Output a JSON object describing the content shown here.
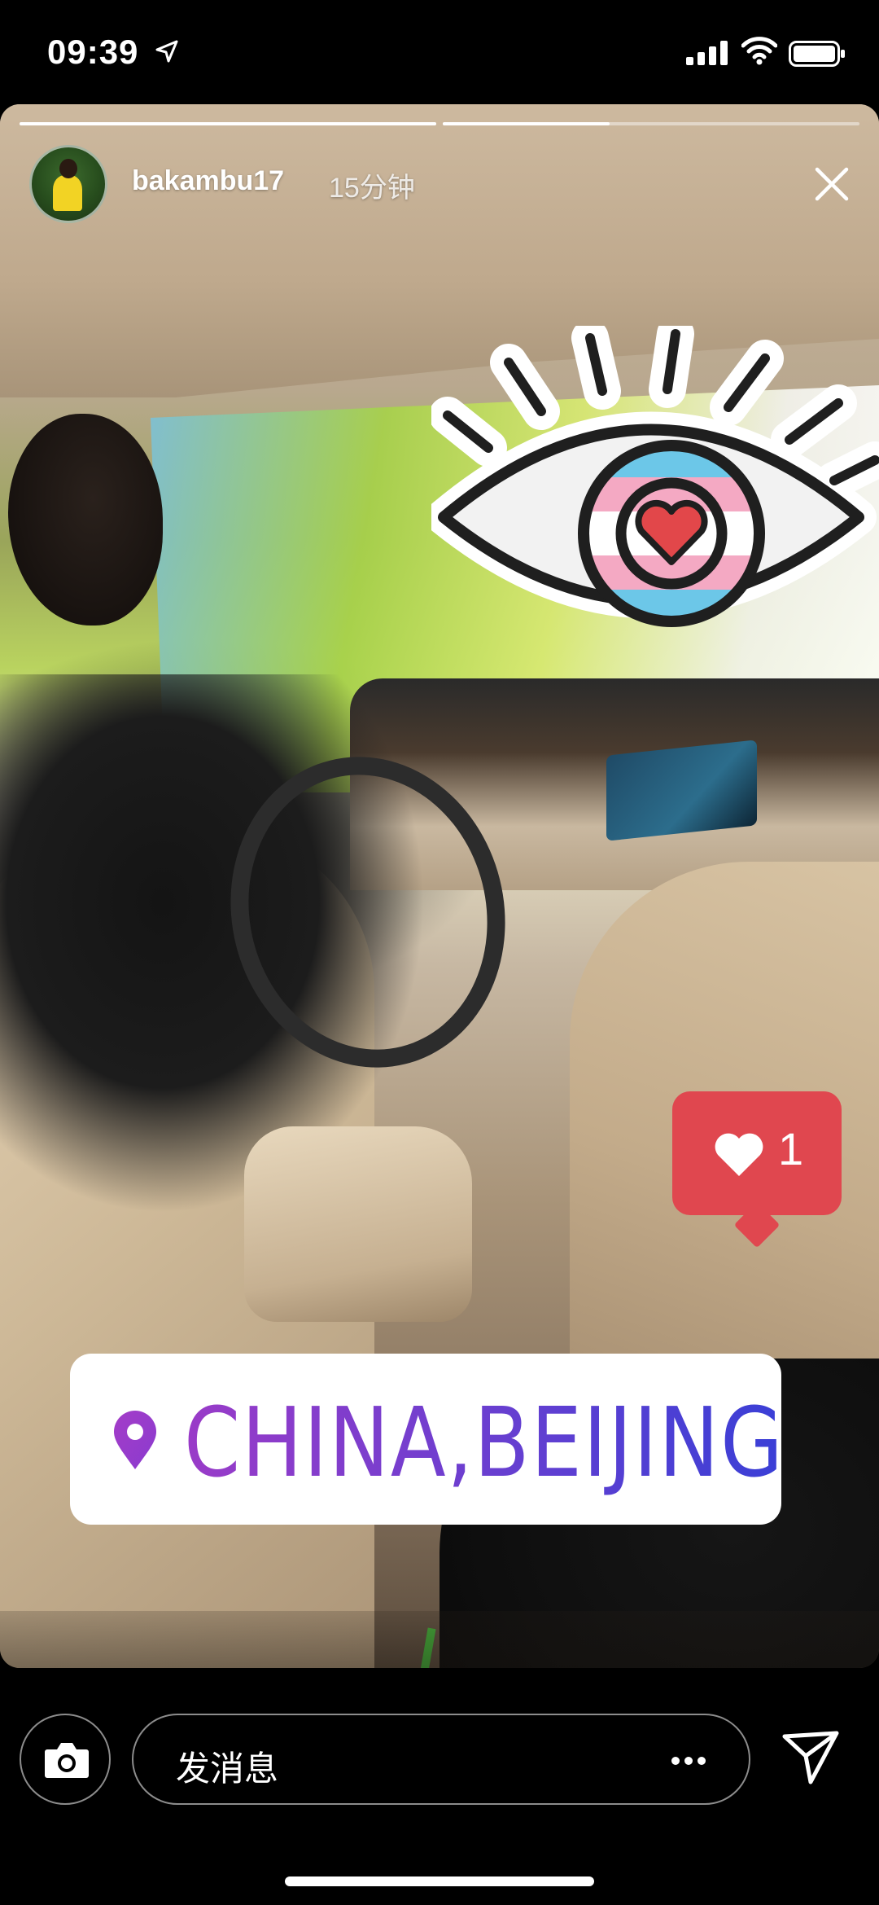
{
  "status_bar": {
    "time": "09:39",
    "icons": [
      "location-arrow-icon",
      "cellular-signal-icon",
      "wifi-icon",
      "battery-icon"
    ]
  },
  "story": {
    "progress": [
      {
        "segment": 1,
        "fill": 1.0
      },
      {
        "segment": 2,
        "fill": 0.4
      }
    ],
    "username": "bakambu17",
    "timestamp": "15分钟",
    "close_icon": "close-icon"
  },
  "stickers": {
    "eye": {
      "icon": "eye-heart-icon",
      "colors": {
        "pink": "#f4a9c3",
        "blue": "#6cc7e8",
        "heart": "#e2474a"
      }
    },
    "like": {
      "icon": "heart-icon",
      "count": "1",
      "color": "#e0474f"
    },
    "location": {
      "icon": "location-pin-icon",
      "text": "CHINA,BEIJING",
      "gradient": [
        "#9a3bc8",
        "#3a3fd6"
      ]
    }
  },
  "bottom_bar": {
    "camera_icon": "camera-icon",
    "message_placeholder": "发消息",
    "more_icon": "more-dots-icon",
    "send_icon": "send-icon"
  }
}
